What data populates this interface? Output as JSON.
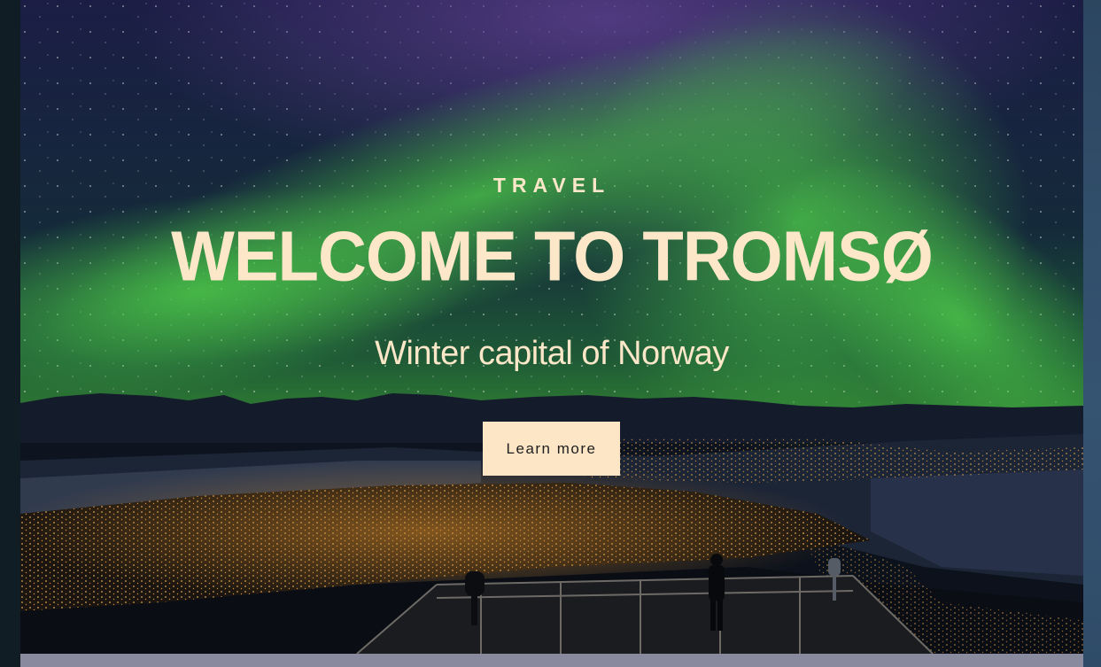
{
  "hero": {
    "eyebrow": "TRAVEL",
    "title": "WELCOME TO TROMSØ",
    "subtitle": "Winter capital of Norway",
    "cta_label": "Learn more"
  },
  "colors": {
    "accent": "#fde6c6",
    "text_light": "#fce7c8",
    "button_text": "#1f1f1f",
    "aurora_green": "#3fbf4a",
    "sky_dark": "#151a3a"
  }
}
